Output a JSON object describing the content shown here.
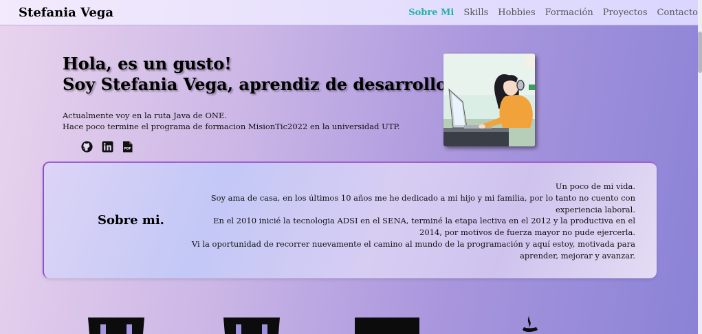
{
  "navbar": {
    "brand": "Stefania Vega",
    "links": [
      "Sobre Mi",
      "Skills",
      "Hobbies",
      "Formación",
      "Proyectos",
      "Contacto"
    ],
    "active_link": "Sobre Mi",
    "accent_color": "#20b2aa"
  },
  "hero": {
    "title_line1": "Hola, es un gusto!",
    "title_line2": "Soy Stefania Vega, aprendiz de desarrollo web.",
    "text_line1": "Actualmente voy en la ruta Java de ONE.",
    "text_line2": "Hace poco termine el programa de formacion MisionTic2022 en la universidad UTP.",
    "socials": [
      "github-icon",
      "linkedin-icon",
      "pdf-icon"
    ],
    "pdf_badge": "PDF"
  },
  "about": {
    "title": "Sobre mi.",
    "lines": [
      "Un poco de mi vida.",
      "Soy ama de casa, en los últimos 10 años me he dedicado a mi hijo y mi familia, por lo tanto no cuento con experiencia laboral.",
      "En el 2010 inicié la tecnologia ADSI en el SENA, terminé la etapa lectiva en el 2012 y la productiva en el 2014, por motivos de fuerza mayor no pude ejercerla.",
      "Vi la oportunidad de recorrer nuevamente el camino al mundo de la programación y aquí estoy, motivada para aprender, mejorar y avanzar."
    ]
  },
  "skills_preview": [
    "html5-icon",
    "css3-icon",
    "javascript-icon",
    "java-icon"
  ]
}
